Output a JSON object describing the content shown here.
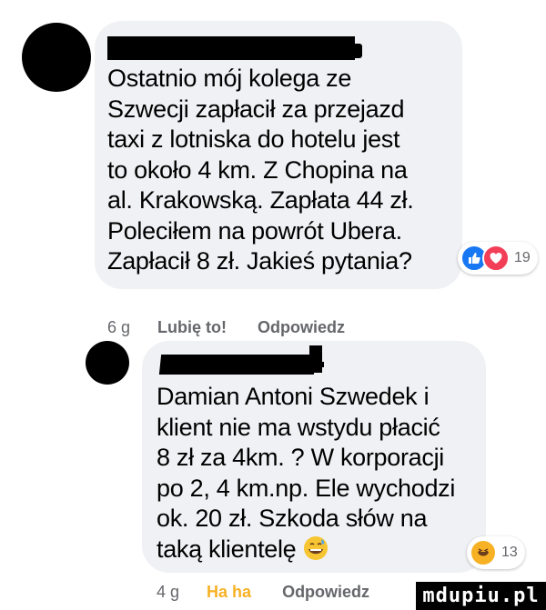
{
  "comments": [
    {
      "text": "Ostatnio mój kolega ze\nSzwecji zapłacił za przejazd\ntaxi z lotniska do hotelu jest\nto około 4 km. Z Chopina na\nal. Krakowską. Zapłata 44 zł.\nPoleciłem na powrót Ubera.\nZapłacił 8 zł. Jakieś pytania?",
      "reactions": {
        "icons": [
          "like-icon",
          "heart-icon"
        ],
        "count": "19"
      },
      "time": "6 g",
      "like_label": "Lubię to!",
      "reply_label": "Odpowiedz"
    },
    {
      "text": "Damian Antoni Szwedek i\nklient nie ma wstydu płacić\n8 zł za 4km. ? W korporacji\npo 2, 4 km.np. Ele wychodzi\nok. 20 zł. Szkoda słów na\ntaką klientelę",
      "emoji": "grinning-sweat-emoji",
      "reactions": {
        "icons": [
          "haha-icon"
        ],
        "count": "13"
      },
      "time": "4 g",
      "like_label": "Ha ha",
      "reply_label": "Odpowiedz"
    }
  ],
  "watermark": "mdupiu.pl",
  "colors": {
    "bubble": "#f0f1f4",
    "meta": "#65676b",
    "like": "#1877f2",
    "heart": "#f33e58",
    "haha": "#f7b125"
  }
}
